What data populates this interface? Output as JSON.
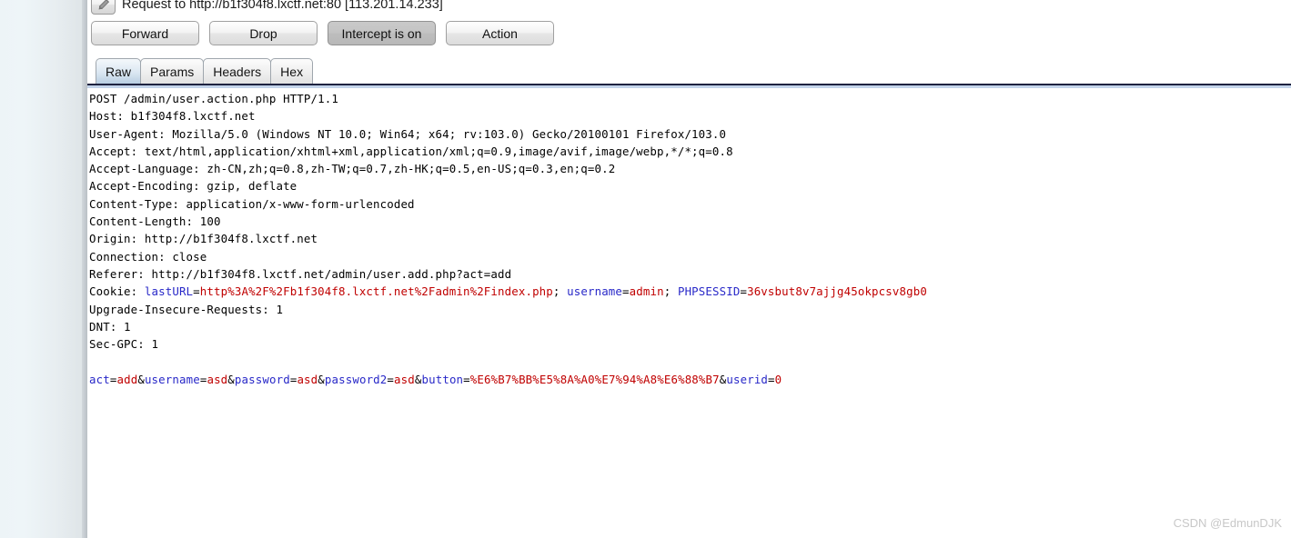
{
  "window": {
    "title": "Request to http://b1f304f8.lxctf.net:80  [113.201.14.233]",
    "edit_icon": "pencil-icon"
  },
  "toolbar": {
    "buttons": [
      {
        "label": "Forward",
        "pressed": false
      },
      {
        "label": "Drop",
        "pressed": false
      },
      {
        "label": "Intercept is on",
        "pressed": true
      },
      {
        "label": "Action",
        "pressed": false
      }
    ]
  },
  "tabs": [
    {
      "label": "Raw",
      "active": true
    },
    {
      "label": "Params",
      "active": false
    },
    {
      "label": "Headers",
      "active": false
    },
    {
      "label": "Hex",
      "active": false
    }
  ],
  "request": {
    "request_line": "POST /admin/user.action.php HTTP/1.1",
    "headers": [
      "Host: b1f304f8.lxctf.net",
      "User-Agent: Mozilla/5.0 (Windows NT 10.0; Win64; x64; rv:103.0) Gecko/20100101 Firefox/103.0",
      "Accept: text/html,application/xhtml+xml,application/xml;q=0.9,image/avif,image/webp,*/*;q=0.8",
      "Accept-Language: zh-CN,zh;q=0.8,zh-TW;q=0.7,zh-HK;q=0.5,en-US;q=0.3,en;q=0.2",
      "Accept-Encoding: gzip, deflate",
      "Content-Type: application/x-www-form-urlencoded",
      "Content-Length: 100",
      "Origin: http://b1f304f8.lxctf.net",
      "Connection: close",
      "Referer: http://b1f304f8.lxctf.net/admin/user.add.php?act=add"
    ],
    "cookie_label": "Cookie: ",
    "cookie_pairs": [
      {
        "name": "lastURL",
        "value": "http%3A%2F%2Fb1f304f8.lxctf.net%2Fadmin%2Findex.php",
        "sep": "; "
      },
      {
        "name": "username",
        "value": "admin",
        "sep": "; "
      },
      {
        "name": "PHPSESSID",
        "value": "36vsbut8v7ajjg45okpcsv8gb0",
        "sep": ""
      }
    ],
    "trailing_headers": [
      "Upgrade-Insecure-Requests: 1",
      "DNT: 1",
      "Sec-GPC: 1"
    ],
    "body_pairs": [
      {
        "name": "act",
        "value": "add",
        "sep": "&"
      },
      {
        "name": "username",
        "value": "asd",
        "sep": "&"
      },
      {
        "name": "password",
        "value": "asd",
        "sep": "&"
      },
      {
        "name": "password2",
        "value": "asd",
        "sep": "&"
      },
      {
        "name": "button",
        "value": "%E6%B7%BB%E5%8A%A0%E7%94%A8%E6%88%B7",
        "sep": "&"
      },
      {
        "name": "userid",
        "value": "0",
        "sep": ""
      }
    ]
  },
  "watermark": "CSDN @EdmunDJK",
  "colors": {
    "param_name": "#2828c8",
    "param_value": "#c00000",
    "rule_dark": "#1e2340",
    "rule_light": "#c3d4ea",
    "watermark": "#c8c8c8"
  }
}
